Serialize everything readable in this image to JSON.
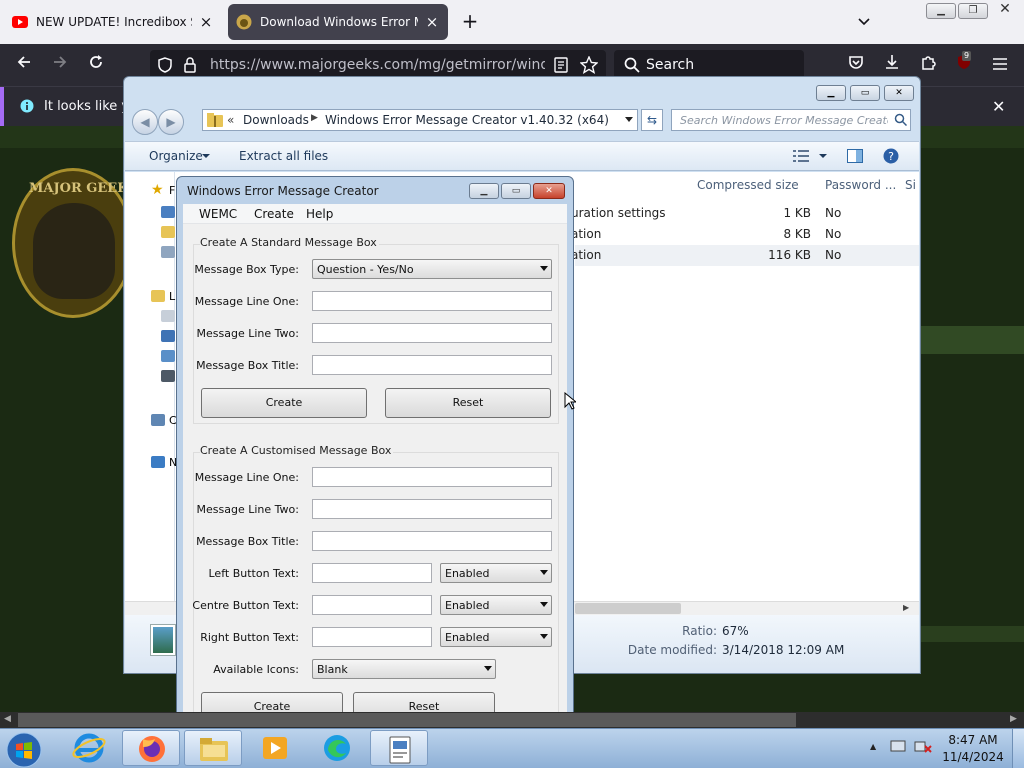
{
  "browser": {
    "tabs": [
      {
        "title": "NEW UPDATE! Incredibox Sprunki",
        "active": false
      },
      {
        "title": "Download Windows Error Message",
        "active": true
      }
    ],
    "url": "https://www.majorgeeks.com/mg/getmirror/windows_error",
    "search_placeholder": "Search",
    "notification": "It looks like you",
    "addon_badge": "9",
    "site_logo_text": "MAJOR GEEKS"
  },
  "explorer": {
    "breadcrumb_chevrons": "«",
    "breadcrumb": [
      "Downloads",
      "Windows Error Message Creator v1.40.32 (x64)"
    ],
    "search_placeholder": "Search Windows Error Message Creator...",
    "commands": {
      "organize": "Organize",
      "extract": "Extract all files"
    },
    "columns": [
      "Compressed size",
      "Password ...",
      "Si"
    ],
    "rows": [
      {
        "name": "uration settings",
        "size": "1 KB",
        "password": "No"
      },
      {
        "name": "ation",
        "size": "8 KB",
        "password": "No"
      },
      {
        "name": "ation",
        "size": "116 KB",
        "password": "No"
      }
    ],
    "details": {
      "ratio_label": "Ratio:",
      "ratio_value": "67%",
      "modified_label": "Date modified:",
      "modified_value": "3/14/2018 12:09 AM"
    },
    "nav_letters": [
      "F",
      "L",
      "C",
      "N"
    ]
  },
  "wemc": {
    "title": "Windows Error Message Creator",
    "menu": [
      "WEMC",
      "Create",
      "Help"
    ],
    "standard": {
      "group_title": "Create A Standard Message Box",
      "type_label": "Message Box Type:",
      "type_value": "Question - Yes/No",
      "line1_label": "Message Line One:",
      "line2_label": "Message Line Two:",
      "title_label": "Message Box Title:",
      "create_label": "Create",
      "reset_label": "Reset"
    },
    "custom": {
      "group_title": "Create A Customised Message Box",
      "line1_label": "Message Line One:",
      "line2_label": "Message Line Two:",
      "title_label": "Message Box Title:",
      "left_label": "Left Button Text:",
      "left_state": "Enabled",
      "centre_label": "Centre Button Text:",
      "centre_state": "Enabled",
      "right_label": "Right Button Text:",
      "right_state": "Enabled",
      "icons_label": "Available Icons:",
      "icons_value": "Blank",
      "create_label": "Create",
      "reset_label": "Reset"
    }
  },
  "taskbar": {
    "time": "8:47 AM",
    "date": "11/4/2024",
    "apps": [
      "start",
      "internet-explorer",
      "firefox",
      "file-explorer",
      "media-player",
      "edge",
      "wemc"
    ]
  }
}
